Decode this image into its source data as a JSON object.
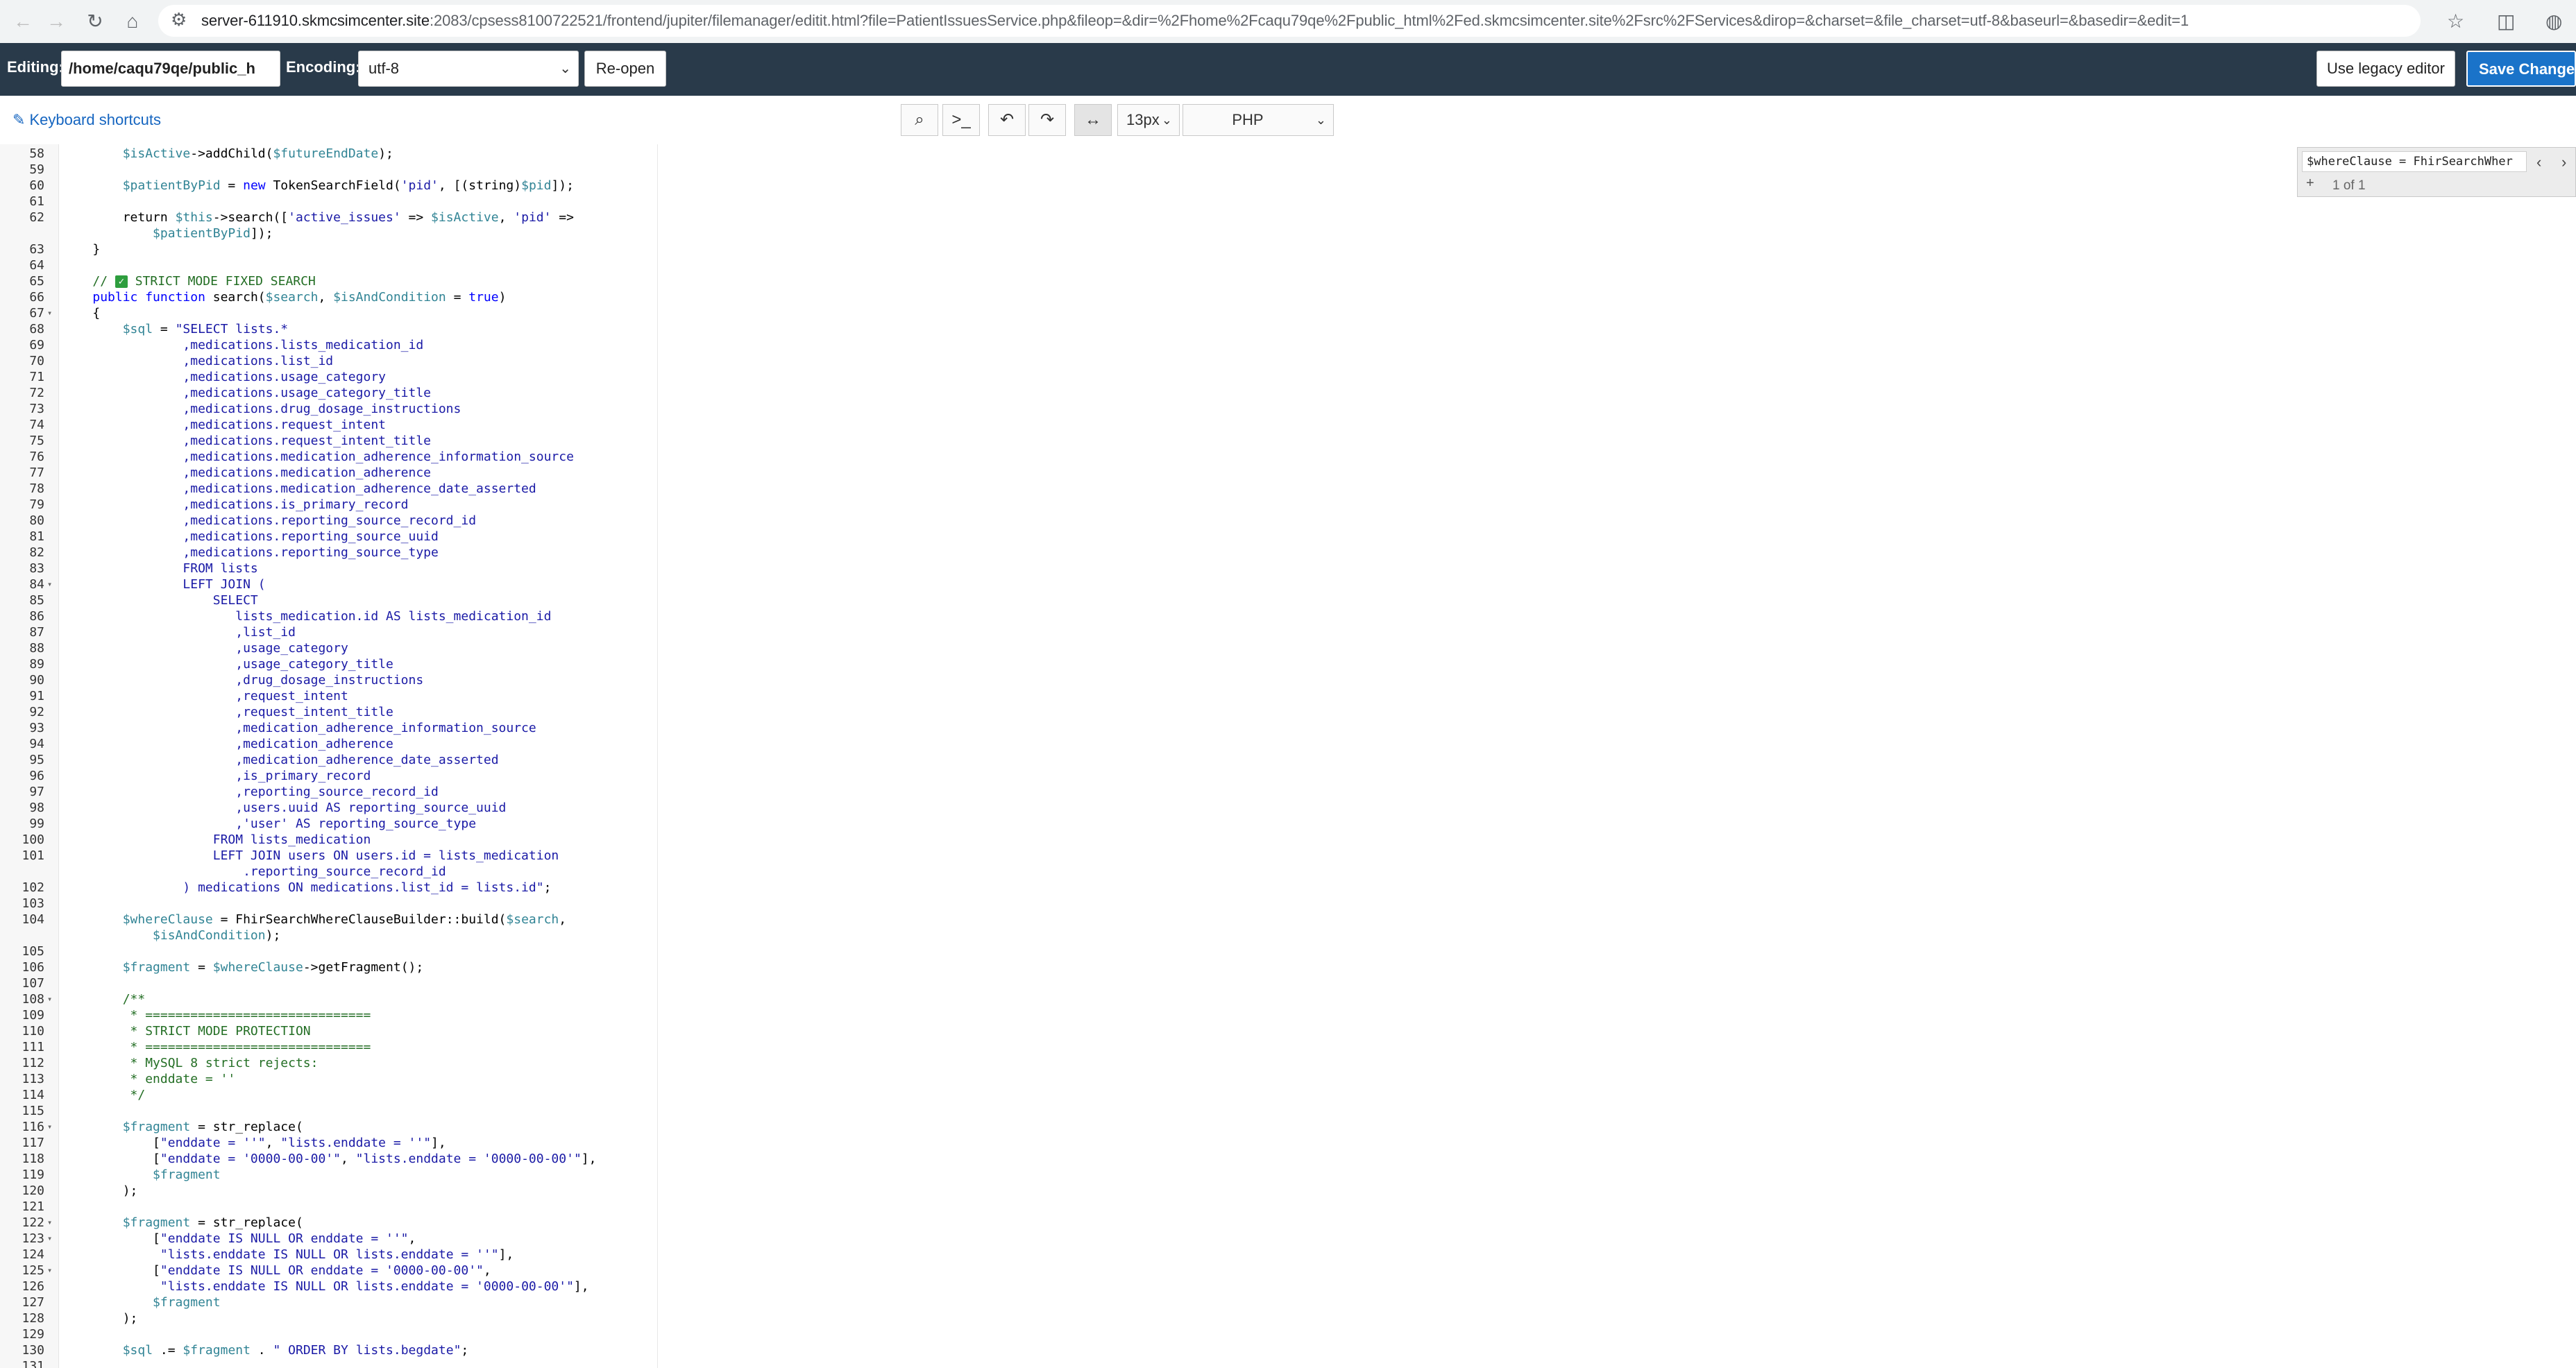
{
  "browser": {
    "url_host": "server-611910.skmcsimcenter.site",
    "url_rest": ":2083/cpsess8100722521/frontend/jupiter/filemanager/editit.html?file=PatientIssuesService.php&fileop=&dir=%2Fhome%2Fcaqu79qe%2Fpublic_html%2Fed.skmcsimcenter.site%2Fsrc%2FServices&dirop=&charset=&file_charset=utf-8&baseurl=&basedir=&edit=1"
  },
  "editor_toolbar": {
    "editing_label": "Editing:",
    "path_value": "/home/caqu79qe/public_h",
    "encoding_label": "Encoding:",
    "encoding_value": "utf-8",
    "reopen_label": "Re-open",
    "legacy_label": "Use legacy editor",
    "save_label": "Save Changes"
  },
  "sub_toolbar": {
    "shortcuts_label": "Keyboard shortcuts",
    "font_size": "13px",
    "mode": "PHP"
  },
  "search": {
    "query": "$whereClause = FhirSearchWher",
    "count": "1 of 1"
  },
  "code_lines": [
    {
      "n": "58",
      "html": "        <span class=\"v\">$isActive</span>-&gt;addChild(<span class=\"v\">$futureEndDate</span>);"
    },
    {
      "n": "59",
      "html": ""
    },
    {
      "n": "60",
      "html": "        <span class=\"v\">$patientByPid</span> = <span class=\"k\">new</span> TokenSearchField(<span class=\"s\">'pid'</span>, [(string)<span class=\"v\">$pid</span>]);"
    },
    {
      "n": "61",
      "html": ""
    },
    {
      "n": "62",
      "html": "        return <span class=\"v\">$this</span>-&gt;search([<span class=\"s\">'active_issues'</span> =&gt; <span class=\"v\">$isActive</span>, <span class=\"s\">'pid'</span> =&gt;"
    },
    {
      "n": "",
      "html": "            <span class=\"v\">$patientByPid</span>]);"
    },
    {
      "n": "63",
      "html": "    }"
    },
    {
      "n": "64",
      "html": ""
    },
    {
      "n": "65",
      "html": "    <span class=\"c\">// <span class=\"check\">✓</span> STRICT MODE FIXED SEARCH</span>"
    },
    {
      "n": "66",
      "html": "    <span class=\"k\">public function</span> search(<span class=\"v\">$search</span>, <span class=\"v\">$isAndCondition</span> = <span class=\"k\">true</span>)"
    },
    {
      "n": "67",
      "fold": true,
      "html": "    {"
    },
    {
      "n": "68",
      "html": "        <span class=\"v\">$sql</span> = <span class=\"s\">\"SELECT lists.*</span>"
    },
    {
      "n": "69",
      "html": "<span class=\"s\">                ,medications.lists_medication_id</span>"
    },
    {
      "n": "70",
      "html": "<span class=\"s\">                ,medications.list_id</span>"
    },
    {
      "n": "71",
      "html": "<span class=\"s\">                ,medications.usage_category</span>"
    },
    {
      "n": "72",
      "html": "<span class=\"s\">                ,medications.usage_category_title</span>"
    },
    {
      "n": "73",
      "html": "<span class=\"s\">                ,medications.drug_dosage_instructions</span>"
    },
    {
      "n": "74",
      "html": "<span class=\"s\">                ,medications.request_intent</span>"
    },
    {
      "n": "75",
      "html": "<span class=\"s\">                ,medications.request_intent_title</span>"
    },
    {
      "n": "76",
      "html": "<span class=\"s\">                ,medications.medication_adherence_information_source</span>"
    },
    {
      "n": "77",
      "html": "<span class=\"s\">                ,medications.medication_adherence</span>"
    },
    {
      "n": "78",
      "html": "<span class=\"s\">                ,medications.medication_adherence_date_asserted</span>"
    },
    {
      "n": "79",
      "html": "<span class=\"s\">                ,medications.is_primary_record</span>"
    },
    {
      "n": "80",
      "html": "<span class=\"s\">                ,medications.reporting_source_record_id</span>"
    },
    {
      "n": "81",
      "html": "<span class=\"s\">                ,medications.reporting_source_uuid</span>"
    },
    {
      "n": "82",
      "html": "<span class=\"s\">                ,medications.reporting_source_type</span>"
    },
    {
      "n": "83",
      "html": "<span class=\"s\">                FROM lists</span>"
    },
    {
      "n": "84",
      "fold": true,
      "html": "<span class=\"s\">                LEFT JOIN (</span>"
    },
    {
      "n": "85",
      "html": "<span class=\"s\">                    SELECT</span>"
    },
    {
      "n": "86",
      "html": "<span class=\"s\">                       lists_medication.id AS lists_medication_id</span>"
    },
    {
      "n": "87",
      "html": "<span class=\"s\">                       ,list_id</span>"
    },
    {
      "n": "88",
      "html": "<span class=\"s\">                       ,usage_category</span>"
    },
    {
      "n": "89",
      "html": "<span class=\"s\">                       ,usage_category_title</span>"
    },
    {
      "n": "90",
      "html": "<span class=\"s\">                       ,drug_dosage_instructions</span>"
    },
    {
      "n": "91",
      "html": "<span class=\"s\">                       ,request_intent</span>"
    },
    {
      "n": "92",
      "html": "<span class=\"s\">                       ,request_intent_title</span>"
    },
    {
      "n": "93",
      "html": "<span class=\"s\">                       ,medication_adherence_information_source</span>"
    },
    {
      "n": "94",
      "html": "<span class=\"s\">                       ,medication_adherence</span>"
    },
    {
      "n": "95",
      "html": "<span class=\"s\">                       ,medication_adherence_date_asserted</span>"
    },
    {
      "n": "96",
      "html": "<span class=\"s\">                       ,is_primary_record</span>"
    },
    {
      "n": "97",
      "html": "<span class=\"s\">                       ,reporting_source_record_id</span>"
    },
    {
      "n": "98",
      "html": "<span class=\"s\">                       ,users.uuid AS reporting_source_uuid</span>"
    },
    {
      "n": "99",
      "html": "<span class=\"s\">                       ,'user' AS reporting_source_type</span>"
    },
    {
      "n": "100",
      "html": "<span class=\"s\">                    FROM lists_medication</span>"
    },
    {
      "n": "101",
      "html": "<span class=\"s\">                    LEFT JOIN users ON users.id = lists_medication</span>"
    },
    {
      "n": "",
      "html": "<span class=\"s\">                        .reporting_source_record_id</span>"
    },
    {
      "n": "102",
      "html": "<span class=\"s\">                ) medications ON medications.list_id = lists.id\"</span>;"
    },
    {
      "n": "103",
      "html": ""
    },
    {
      "n": "104",
      "html": "        <span class=\"v\">$whereClause</span> = FhirSearchWhereClauseBuilder::build(<span class=\"v\">$search</span>,"
    },
    {
      "n": "",
      "html": "            <span class=\"v\">$isAndCondition</span>);"
    },
    {
      "n": "105",
      "html": ""
    },
    {
      "n": "106",
      "html": "        <span class=\"v\">$fragment</span> = <span class=\"v\">$whereClause</span>-&gt;getFragment();"
    },
    {
      "n": "107",
      "html": ""
    },
    {
      "n": "108",
      "fold": true,
      "html": "        <span class=\"c\">/**</span>"
    },
    {
      "n": "109",
      "html": "<span class=\"c\">         * ==============================</span>"
    },
    {
      "n": "110",
      "html": "<span class=\"c\">         * STRICT MODE PROTECTION</span>"
    },
    {
      "n": "111",
      "html": "<span class=\"c\">         * ==============================</span>"
    },
    {
      "n": "112",
      "html": "<span class=\"c\">         * MySQL 8 strict rejects:</span>"
    },
    {
      "n": "113",
      "html": "<span class=\"c\">         * enddate = ''</span>"
    },
    {
      "n": "114",
      "html": "<span class=\"c\">         */</span>"
    },
    {
      "n": "115",
      "html": ""
    },
    {
      "n": "116",
      "fold": true,
      "html": "        <span class=\"v\">$fragment</span> = str_replace("
    },
    {
      "n": "117",
      "html": "            [<span class=\"s\">\"enddate = ''\"</span>, <span class=\"s\">\"lists.enddate = ''\"</span>],"
    },
    {
      "n": "118",
      "html": "            [<span class=\"s\">\"enddate = '0000-00-00'\"</span>, <span class=\"s\">\"lists.enddate = '0000-00-00'\"</span>],"
    },
    {
      "n": "119",
      "html": "            <span class=\"v\">$fragment</span>"
    },
    {
      "n": "120",
      "html": "        );"
    },
    {
      "n": "121",
      "html": ""
    },
    {
      "n": "122",
      "fold": true,
      "html": "        <span class=\"v\">$fragment</span> = str_replace("
    },
    {
      "n": "123",
      "fold": true,
      "html": "            [<span class=\"s\">\"enddate IS NULL OR enddate = ''\"</span>,"
    },
    {
      "n": "124",
      "html": "             <span class=\"s\">\"lists.enddate IS NULL OR lists.enddate = ''\"</span>],"
    },
    {
      "n": "125",
      "fold": true,
      "html": "            [<span class=\"s\">\"enddate IS NULL OR enddate = '0000-00-00'\"</span>,"
    },
    {
      "n": "126",
      "html": "             <span class=\"s\">\"lists.enddate IS NULL OR lists.enddate = '0000-00-00'\"</span>],"
    },
    {
      "n": "127",
      "html": "            <span class=\"v\">$fragment</span>"
    },
    {
      "n": "128",
      "html": "        );"
    },
    {
      "n": "129",
      "html": ""
    },
    {
      "n": "130",
      "html": "        <span class=\"v\">$sql</span> .= <span class=\"v\">$fragment</span> . <span class=\"s\">\" ORDER BY lists.begdate\"</span>;"
    },
    {
      "n": "131",
      "html": ""
    }
  ]
}
